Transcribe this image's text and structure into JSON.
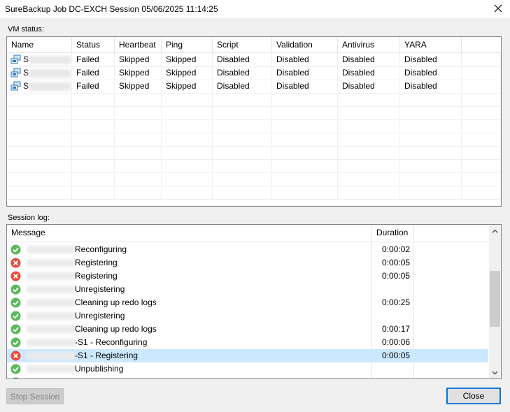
{
  "window": {
    "title": "SureBackup Job DC-EXCH Session 05/06/2025 11:14:25"
  },
  "vm_status": {
    "label": "VM status:",
    "columns": [
      "Name",
      "Status",
      "Heartbeat",
      "Ping",
      "Script",
      "Validation",
      "Antivirus",
      "YARA"
    ],
    "rows": [
      {
        "name_prefix": "S",
        "status": "Failed",
        "heartbeat": "Skipped",
        "ping": "Skipped",
        "script": "Disabled",
        "validation": "Disabled",
        "antivirus": "Disabled",
        "yara": "Disabled"
      },
      {
        "name_prefix": "S",
        "status": "Failed",
        "heartbeat": "Skipped",
        "ping": "Skipped",
        "script": "Disabled",
        "validation": "Disabled",
        "antivirus": "Disabled",
        "yara": "Disabled"
      },
      {
        "name_prefix": "S",
        "status": "Failed",
        "heartbeat": "Skipped",
        "ping": "Skipped",
        "script": "Disabled",
        "validation": "Disabled",
        "antivirus": "Disabled",
        "yara": "Disabled"
      }
    ]
  },
  "session_log": {
    "label": "Session log:",
    "columns": {
      "message": "Message",
      "duration": "Duration"
    },
    "entries": [
      {
        "status": "success",
        "message": "Reconfiguring",
        "duration": "0:00:02"
      },
      {
        "status": "error",
        "message": "Registering",
        "duration": "0:00:05"
      },
      {
        "status": "error",
        "message": "Registering",
        "duration": "0:00:05"
      },
      {
        "status": "success",
        "message": "Unregistering",
        "duration": ""
      },
      {
        "status": "success",
        "message": "Cleaning up redo logs",
        "duration": "0:00:25"
      },
      {
        "status": "success",
        "message": "Unregistering",
        "duration": ""
      },
      {
        "status": "success",
        "message": "Cleaning up redo logs",
        "duration": "0:00:17"
      },
      {
        "status": "success",
        "message": "-S1 - Reconfiguring",
        "duration": "0:00:06"
      },
      {
        "status": "error",
        "message": "-S1 - Registering",
        "duration": "0:00:05",
        "selected": true
      },
      {
        "status": "success",
        "message": "Unpublishing",
        "duration": ""
      }
    ]
  },
  "buttons": {
    "stop_session": "Stop Session",
    "close": "Close"
  },
  "colors": {
    "success": "#5cb85c",
    "error": "#e74c3c",
    "selection": "#cce8ff",
    "accent": "#0078d7"
  },
  "icons": {
    "close": "close-icon",
    "vm": "vm-icon",
    "success": "success-check-icon",
    "error": "error-x-icon",
    "scroll_up": "chevron-up-icon",
    "scroll_down": "chevron-down-icon"
  }
}
